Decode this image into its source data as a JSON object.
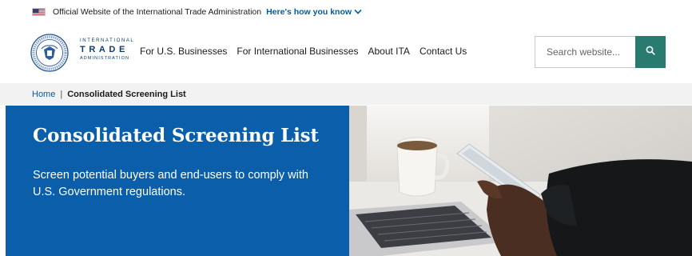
{
  "banner": {
    "text": "Official Website of the International Trade Administration",
    "link": "Here's how you know"
  },
  "logo": {
    "line1": "INTERNATIONAL",
    "line2": "TRADE",
    "line3": "ADMINISTRATION"
  },
  "nav": {
    "items": [
      {
        "label": "For U.S. Businesses"
      },
      {
        "label": "For International Businesses"
      },
      {
        "label": "About ITA"
      },
      {
        "label": "Contact Us"
      }
    ]
  },
  "search": {
    "placeholder": "Search website...",
    "icon": "search-icon"
  },
  "breadcrumb": {
    "home": "Home",
    "separator": "|",
    "current": "Consolidated Screening List"
  },
  "hero": {
    "title": "Consolidated Screening List",
    "subtitle": "Screen potential buyers and end-users to comply with U.S. Government regulations."
  },
  "colors": {
    "hero_bg": "#0a5eaa",
    "search_button": "#2a7b6f",
    "link": "#005ea2",
    "breadcrumb_bg": "#f2f2f2"
  }
}
